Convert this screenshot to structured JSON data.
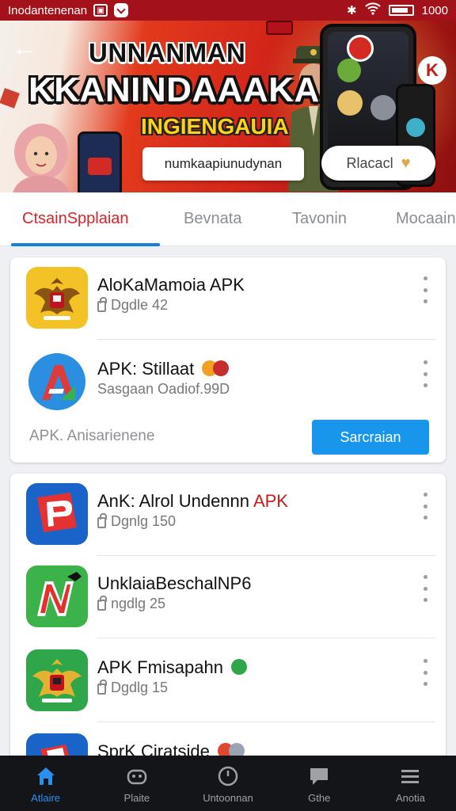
{
  "status_bar": {
    "left_text": "Inodantenenan",
    "time": "1000"
  },
  "banner": {
    "title_line1": "UNNANMAN",
    "title_line2": "KKANINDAAAKA",
    "title_line3": "INGIENGAUIA",
    "input_text": "numkaapiunudynan",
    "button_label": "Rlacacl",
    "close_label": "K"
  },
  "tabs": [
    {
      "label": "CtsainSpplaian",
      "active": true
    },
    {
      "label": "Bevnata"
    },
    {
      "label": "Tavonin"
    },
    {
      "label": "Mocaain"
    }
  ],
  "featured_card": {
    "items": [
      {
        "name": "AloKaMamoia APK",
        "meta": "Dgdle 42",
        "icon": "garuda-emblem-icon"
      },
      {
        "name": "APK: Stillaat",
        "meta": "Sasgaan Oadiof.99D",
        "icon": "a-logo-icon"
      }
    ],
    "footer_text": "APK. Anisarienene",
    "action_button": "Sarcraian"
  },
  "list_card": {
    "items": [
      {
        "name_prefix": "AnK: Alrol Undennn",
        "name_suffix": "APK",
        "meta": "Dgnlg 150",
        "icon": "p-logo-icon"
      },
      {
        "name_prefix": "UnklaiaBeschalNP6",
        "name_suffix": "",
        "meta": "ngdlg 25",
        "icon": "n-logo-icon"
      },
      {
        "name_prefix": "APK Fmisapahn",
        "name_suffix": "",
        "meta": "Dgdlg 15",
        "icon": "garuda-green-icon"
      },
      {
        "name_prefix": "SprK Ciratside",
        "name_suffix": "",
        "meta": "",
        "icon": "folder-icon"
      }
    ]
  },
  "bottom_nav": [
    {
      "label": "Atlaire",
      "icon": "home-icon",
      "active": true
    },
    {
      "label": "Plaite",
      "icon": "gamepad-icon"
    },
    {
      "label": "Untoonnan",
      "icon": "clock-icon"
    },
    {
      "label": "Gthe",
      "icon": "chat-icon"
    },
    {
      "label": "Anotia",
      "icon": "menu-icon"
    }
  ],
  "colors": {
    "primary_red": "#d8232a",
    "accent_blue": "#1896ec",
    "nav_bg": "#141519"
  }
}
